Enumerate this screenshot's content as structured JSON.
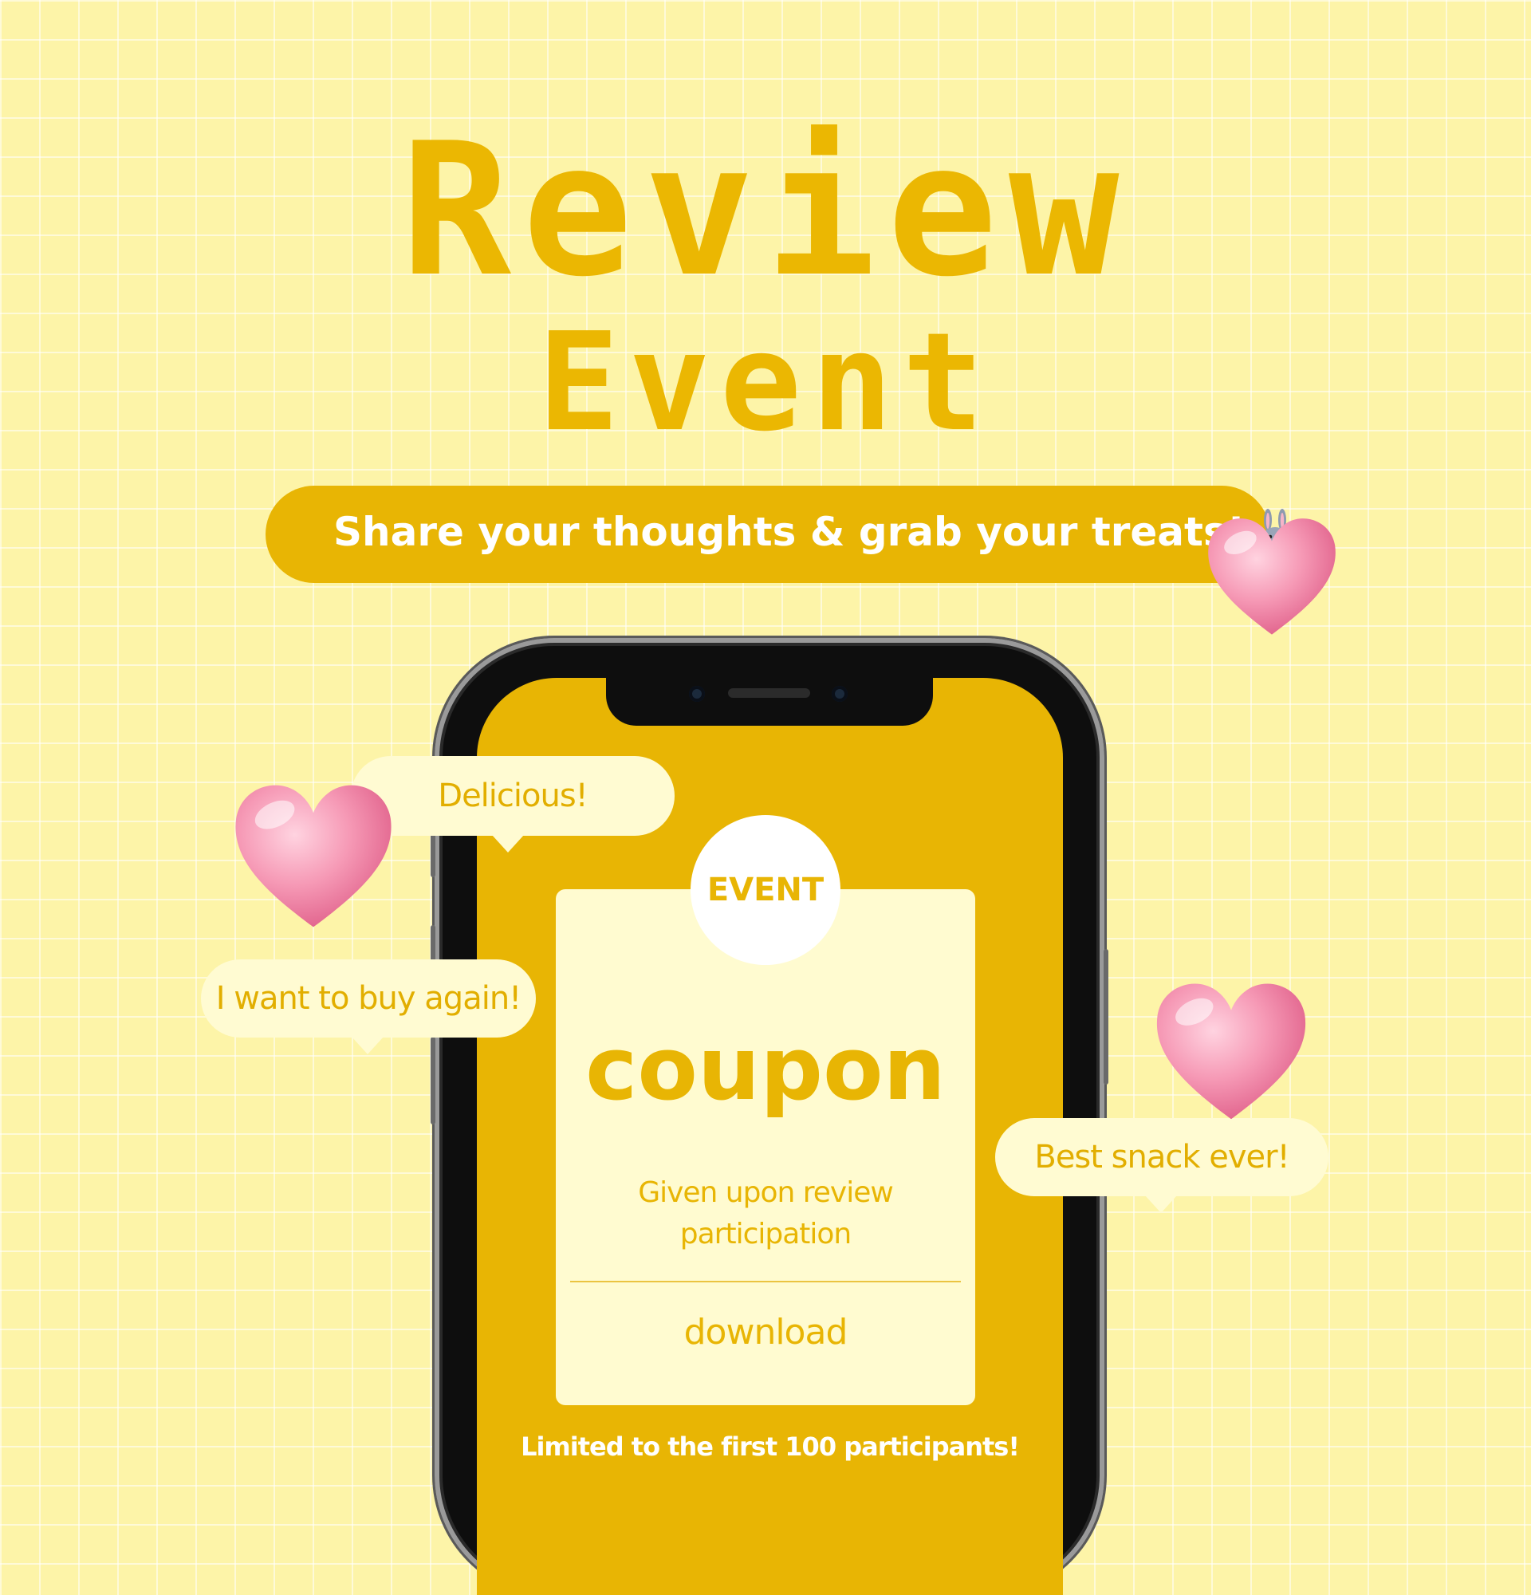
{
  "title": {
    "line1": "Review",
    "line2": "Event"
  },
  "tagline": {
    "text": "Share your thoughts & grab your treats!",
    "emoji": "rabbit-icon"
  },
  "coupon": {
    "badge": "EVENT",
    "title": "coupon",
    "subtitle_line1": "Given upon review",
    "subtitle_line2": "participation",
    "action": "download"
  },
  "footnote": "Limited to the first 100 participants!",
  "bubbles": [
    "Delicious!",
    "I want to buy again!",
    "Best snack ever!"
  ],
  "colors": {
    "background": "#FDF4A8",
    "accent": "#E8B504",
    "card": "#FFFBD0",
    "heart": "#F48FB1",
    "phone_frame": "#0E0E0E"
  },
  "icons": [
    "heart-icon",
    "rabbit-icon",
    "phone-camera-icon"
  ]
}
